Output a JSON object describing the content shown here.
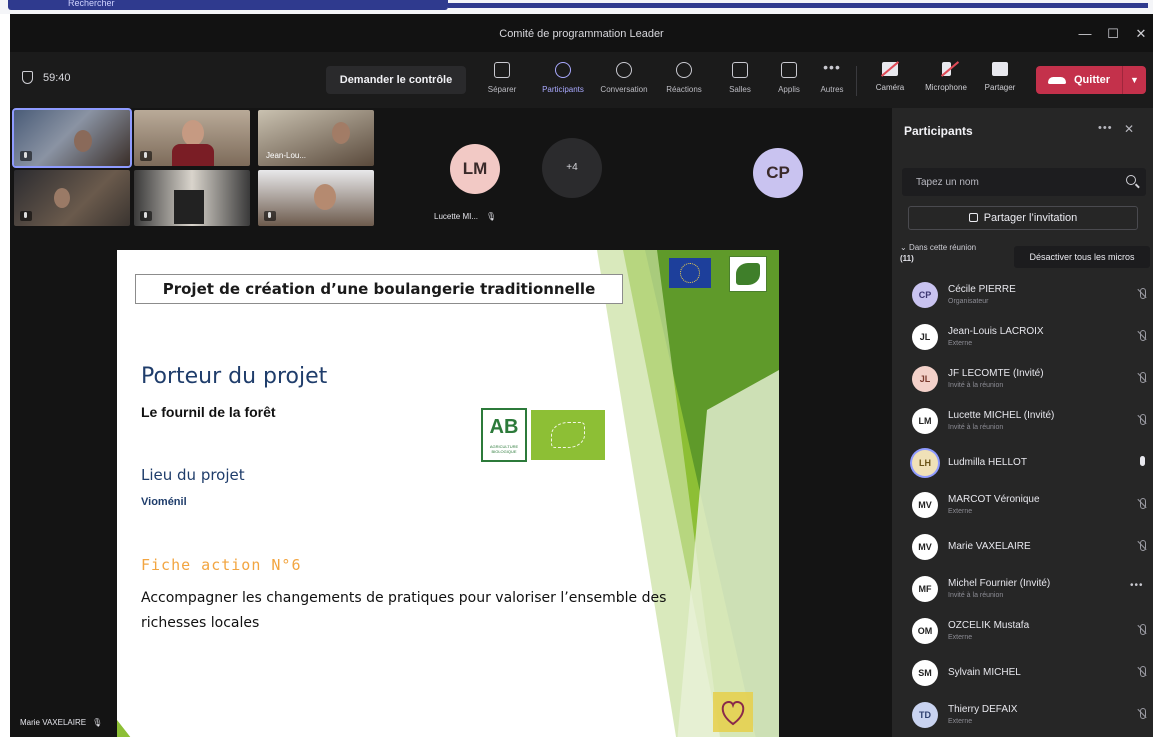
{
  "taskbar": {
    "search_label": "Rechercher"
  },
  "window": {
    "title": "Comité de programmation Leader"
  },
  "toolbar": {
    "timer": "59:40",
    "request_control": "Demander le contrôle",
    "tools": [
      {
        "label": "Séparer"
      },
      {
        "label": "Participants"
      },
      {
        "label": "Conversation"
      },
      {
        "label": "Réactions"
      },
      {
        "label": "Salles"
      },
      {
        "label": "Applis"
      },
      {
        "label": "Autres"
      }
    ],
    "devices": [
      {
        "label": "Caméra"
      },
      {
        "label": "Microphone"
      },
      {
        "label": "Partager"
      }
    ],
    "quit_label": "Quitter"
  },
  "stage": {
    "tiles": [
      {
        "name": ""
      },
      {
        "name": ""
      },
      {
        "name": "Jean-Lou..."
      },
      {
        "name": ""
      },
      {
        "name": ""
      },
      {
        "name": ""
      }
    ],
    "avatar_lm": {
      "initials": "LM",
      "name": "Lucette MI..."
    },
    "overflow": "+4",
    "avatar_cp": {
      "initials": "CP"
    },
    "self_name": "Marie VAXELAIRE"
  },
  "slide": {
    "title": "Projet de création d’une boulangerie traditionnelle",
    "heading1": "Porteur du projet",
    "text1": "Le fournil de la forêt",
    "heading2": "Lieu du projet",
    "text2": "Vioménil",
    "heading3": "Fiche action N°6",
    "text3": "Accompagner les changements de pratiques pour valoriser l’ensemble des richesses locales",
    "ab_logo": "AB",
    "ab_logo_sub": "AGRICULTURE BIOLOGIQUE"
  },
  "panel": {
    "title": "Participants",
    "search_placeholder": "Tapez un nom",
    "invite_label": "Partager l’invitation",
    "section_label": "Dans cette réunion",
    "section_count": "(11)",
    "mute_all": "Désactiver tous les micros",
    "participants": [
      {
        "initials": "CP",
        "name": "Cécile PIERRE",
        "role": "Organisateur",
        "bg": "#c9c3f0",
        "fg": "#3b3470",
        "status": "mic-off"
      },
      {
        "initials": "JL",
        "name": "Jean-Louis LACROIX",
        "role": "Externe",
        "bg": "#ffffff",
        "fg": "#222222",
        "status": "mic-off"
      },
      {
        "initials": "JL",
        "name": "JF LECOMTE (Invité)",
        "role": "Invité à la réunion",
        "bg": "#f3d1c9",
        "fg": "#7a3a2e",
        "status": "mic-off"
      },
      {
        "initials": "LM",
        "name": "Lucette MICHEL (Invité)",
        "role": "Invité à la réunion",
        "bg": "#ffffff",
        "fg": "#222222",
        "status": "mic-off"
      },
      {
        "initials": "LH",
        "name": "Ludmilla HELLOT",
        "role": "",
        "bg": "#f0e1b8",
        "fg": "#6b5417",
        "status": "mic-on"
      },
      {
        "initials": "MV",
        "name": "MARCOT Véronique",
        "role": "Externe",
        "bg": "#ffffff",
        "fg": "#222222",
        "status": "mic-off"
      },
      {
        "initials": "MV",
        "name": "Marie VAXELAIRE",
        "role": "",
        "bg": "#ffffff",
        "fg": "#222222",
        "status": "mic-off"
      },
      {
        "initials": "MF",
        "name": "Michel Fournier (Invité)",
        "role": "Invité à la réunion",
        "bg": "#ffffff",
        "fg": "#222222",
        "status": "more"
      },
      {
        "initials": "OM",
        "name": "OZCELIK Mustafa",
        "role": "Externe",
        "bg": "#ffffff",
        "fg": "#222222",
        "status": "mic-off"
      },
      {
        "initials": "SM",
        "name": "Sylvain MICHEL",
        "role": "",
        "bg": "#ffffff",
        "fg": "#222222",
        "status": "mic-off"
      },
      {
        "initials": "TD",
        "name": "Thierry DEFAIX",
        "role": "Externe",
        "bg": "#c9d3f0",
        "fg": "#2e3f70",
        "status": "mic-off"
      }
    ]
  },
  "colors": {
    "accent": "#8f9bff",
    "quit": "#c4314b",
    "slide_title": "#1f3d6b",
    "slide_orange": "#f2a541",
    "slide_green": "#8dbf35"
  },
  "icons": {
    "search": "search-icon",
    "shield": "shield-icon",
    "phone": "phone-hangup-icon",
    "mic_off": "mic-off-icon",
    "mic_on": "mic-icon"
  }
}
